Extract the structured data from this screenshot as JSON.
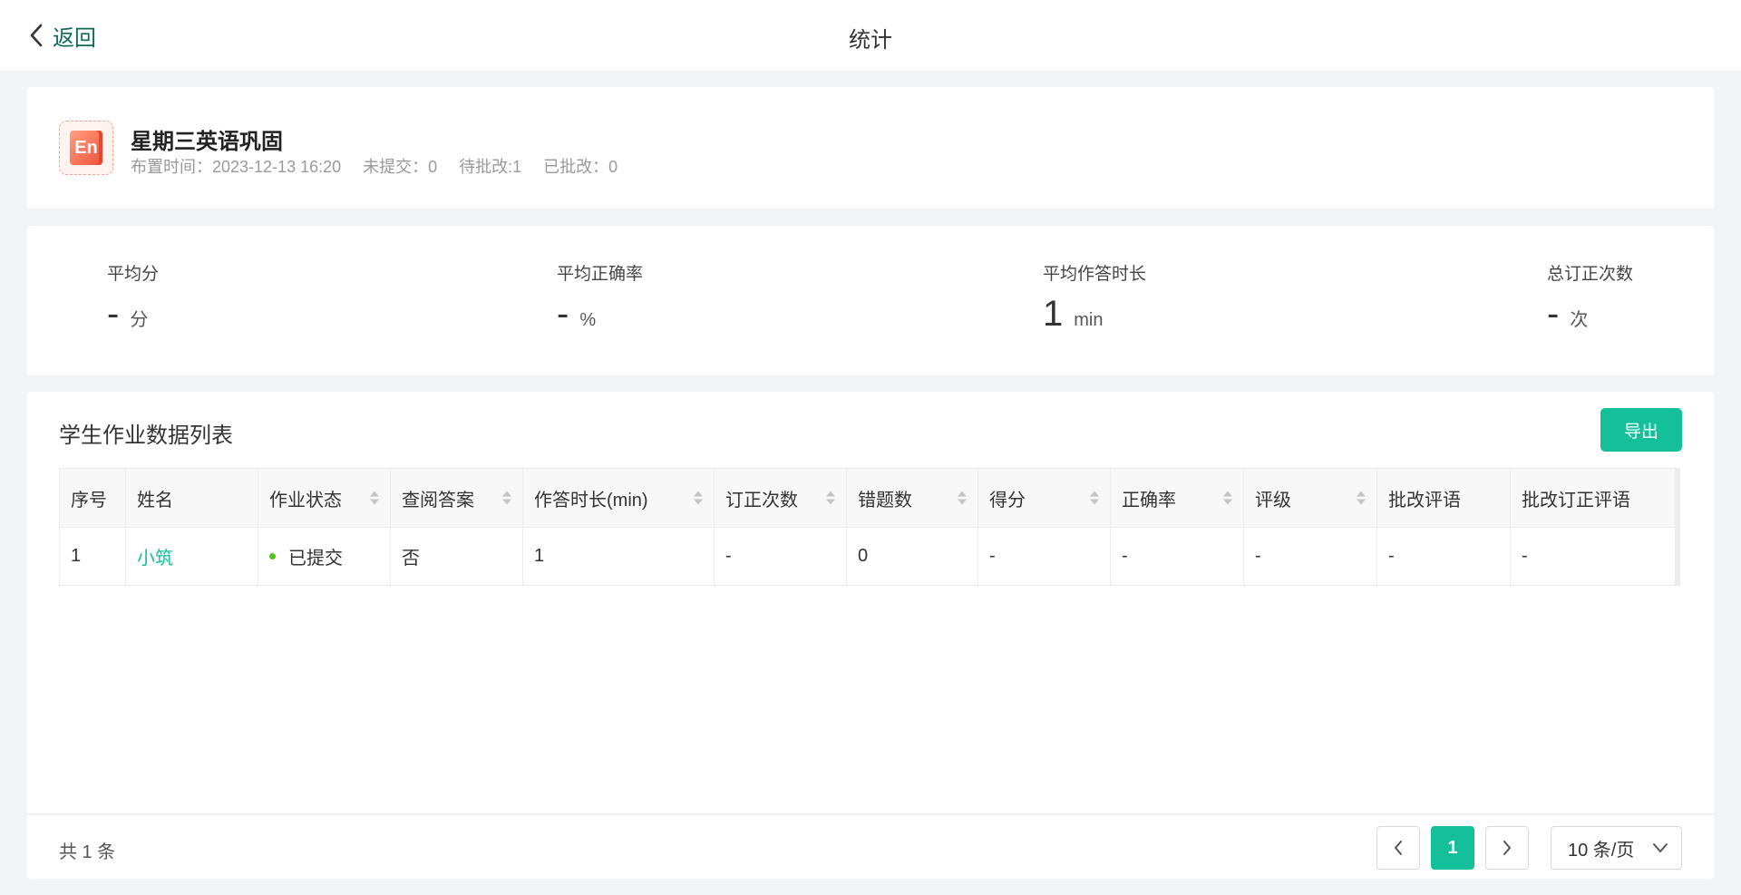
{
  "header": {
    "back_label": "返回",
    "title": "统计"
  },
  "homework": {
    "icon_text": "En",
    "title": "星期三英语巩固",
    "assigned_time": "布置时间：2023-12-13 16:20",
    "not_submitted": "未提交：0",
    "pending_review": "待批改:1",
    "reviewed": "已批改：0"
  },
  "stats": {
    "avg_score": {
      "label": "平均分",
      "value": "-",
      "unit": "分"
    },
    "avg_accuracy": {
      "label": "平均正确率",
      "value": "-",
      "unit": "%"
    },
    "avg_duration": {
      "label": "平均作答时长",
      "value": "1",
      "unit": "min"
    },
    "total_corrections": {
      "label": "总订正次数",
      "value": "-",
      "unit": "次"
    }
  },
  "list": {
    "title": "学生作业数据列表",
    "export_label": "导出",
    "columns": [
      {
        "label": "序号",
        "sortable": false
      },
      {
        "label": "姓名",
        "sortable": false
      },
      {
        "label": "作业状态",
        "sortable": true
      },
      {
        "label": "查阅答案",
        "sortable": true
      },
      {
        "label": "作答时长(min)",
        "sortable": true
      },
      {
        "label": "订正次数",
        "sortable": true
      },
      {
        "label": "错题数",
        "sortable": true
      },
      {
        "label": "得分",
        "sortable": true
      },
      {
        "label": "正确率",
        "sortable": true
      },
      {
        "label": "评级",
        "sortable": true
      },
      {
        "label": "批改评语",
        "sortable": false
      },
      {
        "label": "批改订正评语",
        "sortable": false
      }
    ],
    "rows": [
      [
        "1",
        "小筑",
        "已提交",
        "否",
        "1",
        "-",
        "0",
        "-",
        "-",
        "-",
        "-",
        "-"
      ]
    ],
    "status_color": "#52c41a"
  },
  "pagination": {
    "total": "共 1 条",
    "current_page": "1",
    "page_size": "10 条/页"
  },
  "colors": {
    "accent": "#14bf9c",
    "background": "#f2f3f7"
  }
}
